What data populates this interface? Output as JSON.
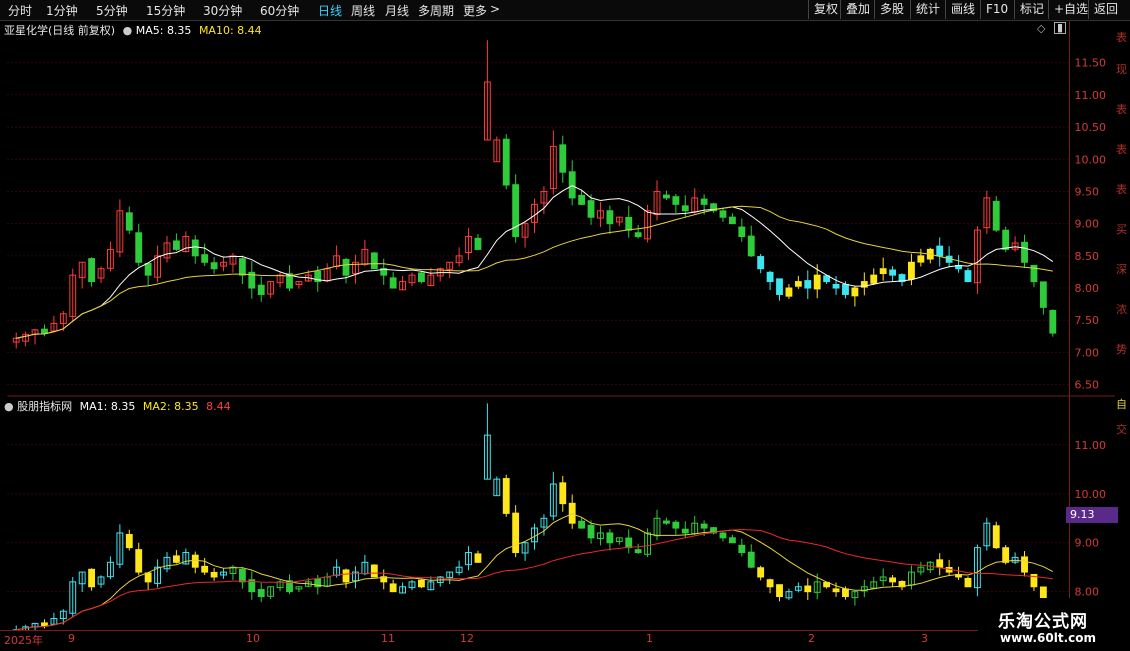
{
  "toolbar": {
    "periods": [
      "分时",
      "1分钟",
      "5分钟",
      "15分钟",
      "30分钟",
      "60分钟",
      "日线",
      "周线",
      "月线",
      "多周期",
      "更多"
    ],
    "active_period": "日线",
    "more_arrow": ">",
    "buttons": [
      "复权",
      "叠加",
      "多股",
      "统计",
      "画线",
      "F10",
      "标记",
      "+自选",
      "返回"
    ]
  },
  "main_chart": {
    "stock_name": "亚星化学(日线 前复权)",
    "ma5_label": "MA5:",
    "ma5_value": "8.35",
    "ma10_label": "MA10:",
    "ma10_value": "8.44",
    "y_ticks": [
      "11.50",
      "11.00",
      "10.50",
      "10.00",
      "9.50",
      "9.00",
      "8.50",
      "8.00",
      "7.50",
      "7.00",
      "6.50"
    ]
  },
  "sub_chart": {
    "name": "股朋指标网",
    "ma1_label": "MA1:",
    "ma1_value": "8.35",
    "ma2_label": "MA2:",
    "ma2_value": "8.35",
    "extra_value": "8.44",
    "y_ticks": [
      "11.00",
      "10.00",
      "9.00",
      "8.00"
    ],
    "current_price_tag": "9.13"
  },
  "date_axis": [
    "2025年",
    "9",
    "10",
    "11",
    "12",
    "1",
    "2",
    "3"
  ],
  "colors": {
    "up": "#ff3a3a",
    "down_green": "#2ecc3a",
    "cyan": "#3ae6f0",
    "yellow": "#ffe619",
    "ma_white": "#ffffff",
    "ma_yellow": "#e6d23c",
    "grid": "#5a1010"
  },
  "watermark": {
    "title": "乐淘公式网",
    "url": "www.60lt.com"
  },
  "chart_data": {
    "type": "candlestick",
    "price_axis_range": [
      6.4,
      11.9
    ],
    "color_regimes": [
      "red/green",
      "cyan/yellow"
    ],
    "closes": [
      7.22,
      7.28,
      7.35,
      7.3,
      7.45,
      7.6,
      8.2,
      8.4,
      8.1,
      8.3,
      8.6,
      9.2,
      8.9,
      8.4,
      8.2,
      8.5,
      8.7,
      8.6,
      8.8,
      8.5,
      8.4,
      8.3,
      8.4,
      8.5,
      8.2,
      8.0,
      7.9,
      8.1,
      8.2,
      8.0,
      8.1,
      8.2,
      8.1,
      8.3,
      8.5,
      8.2,
      8.4,
      8.6,
      8.3,
      8.2,
      8.0,
      8.1,
      8.2,
      8.1,
      8.2,
      8.3,
      8.4,
      8.5,
      8.8,
      8.6,
      10.0,
      10.3,
      9.6,
      8.8,
      9.0,
      9.3,
      9.5,
      10.2,
      9.8,
      9.4,
      9.3,
      9.1,
      9.2,
      9.0,
      9.1,
      8.9,
      8.8,
      9.2,
      9.5,
      9.4,
      9.3,
      9.2,
      9.4,
      9.3,
      9.2,
      9.1,
      9.0,
      8.8,
      8.5,
      8.3,
      8.1,
      7.9,
      8.0,
      8.1,
      8.0,
      8.2,
      8.1,
      8.0,
      7.9,
      8.0,
      8.1,
      8.2,
      8.3,
      8.2,
      8.1,
      8.4,
      8.5,
      8.6,
      8.5,
      8.4,
      8.3,
      8.1,
      8.9,
      9.4,
      8.9,
      8.6,
      8.7,
      8.4,
      8.1,
      7.7,
      7.3
    ]
  }
}
